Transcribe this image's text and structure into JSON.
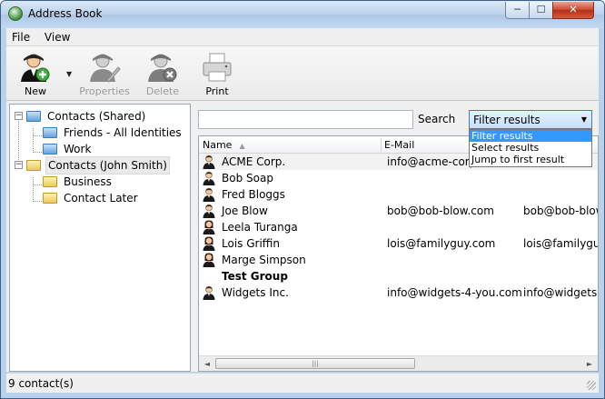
{
  "window": {
    "title": "Address Book"
  },
  "titlebar_buttons": {
    "minimize": "─",
    "maximize": "☐",
    "close": "✕"
  },
  "menu": {
    "file": "File",
    "view": "View"
  },
  "toolbar": {
    "new_label": "New",
    "properties_label": "Properties",
    "delete_label": "Delete",
    "print_label": "Print",
    "split_arrow": "▼"
  },
  "tree": {
    "toggle_expanded": "−",
    "items": [
      {
        "label": "Contacts (Shared)"
      },
      {
        "label": "Friends - All Identities"
      },
      {
        "label": "Work"
      },
      {
        "label": "Contacts (John Smith)"
      },
      {
        "label": "Business"
      },
      {
        "label": "Contact Later"
      }
    ]
  },
  "search": {
    "label": "Search",
    "value": ""
  },
  "filter": {
    "selected": "Filter results",
    "arrow": "▼",
    "options": [
      "Filter results",
      "Select results",
      "Jump to first result"
    ]
  },
  "grid": {
    "columns": {
      "name": "Name",
      "email": "E-Mail"
    },
    "sort_indicator": "▲",
    "rows": [
      {
        "name": "ACME Corp.",
        "email": "info@acme-corp.",
        "email2": ""
      },
      {
        "name": "Bob Soap",
        "email": "",
        "email2": ""
      },
      {
        "name": "Fred Bloggs",
        "email": "",
        "email2": ""
      },
      {
        "name": "Joe Blow",
        "email": "bob@bob-blow.com",
        "email2": "bob@bob-blow"
      },
      {
        "name": "Leela Turanga",
        "email": "",
        "email2": ""
      },
      {
        "name": "Lois Griffin",
        "email": "lois@familyguy.com",
        "email2": "lois@familyguy."
      },
      {
        "name": "Marge Simpson",
        "email": "",
        "email2": ""
      },
      {
        "name": "Test Group",
        "email": "",
        "email2": ""
      },
      {
        "name": "Widgets Inc.",
        "email": "info@widgets-4-you.com",
        "email2": "info@widgets-4"
      }
    ]
  },
  "scroll": {
    "left_arrow": "◄",
    "right_arrow": "►",
    "thumb_grip": "|||"
  },
  "status": {
    "text": "9 contact(s)"
  },
  "colors": {
    "accent": "#3399ff",
    "window_frame": "#b9d1ea"
  }
}
